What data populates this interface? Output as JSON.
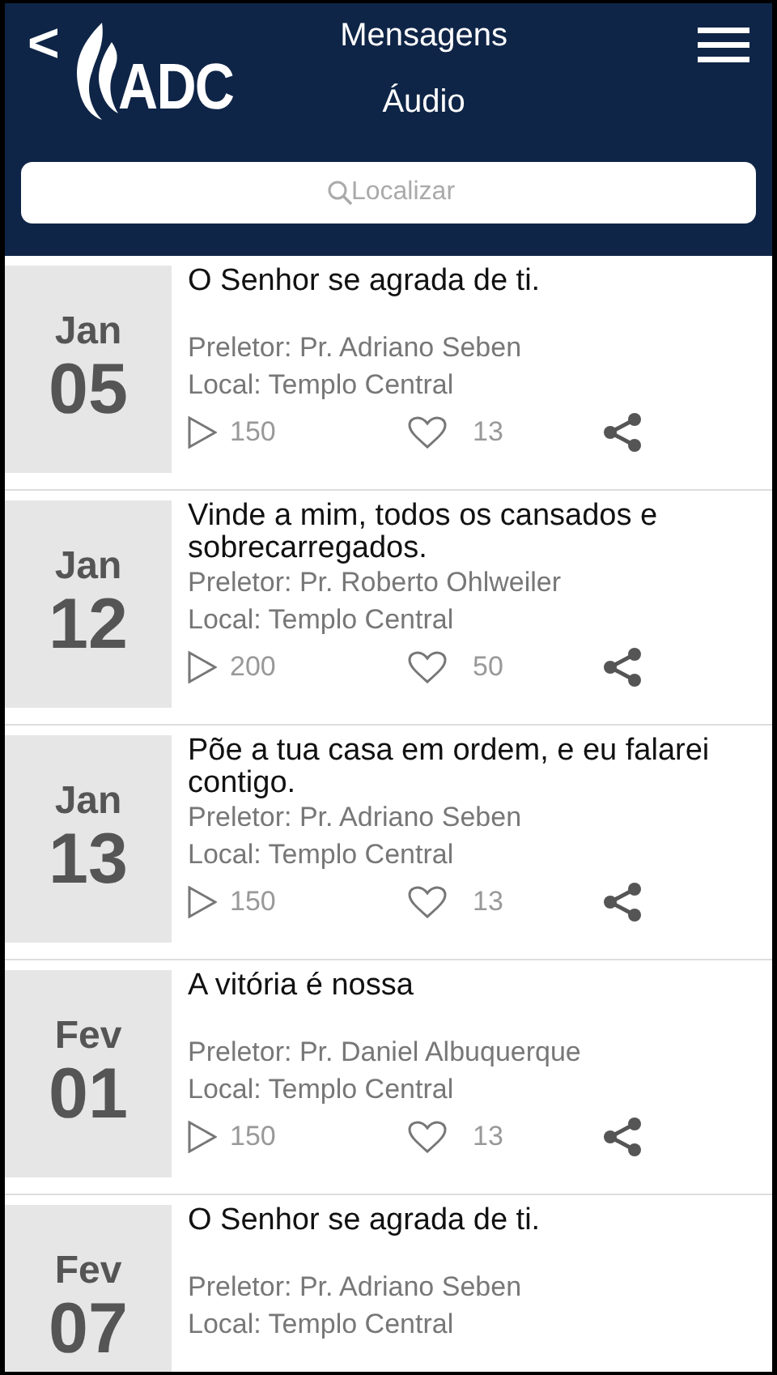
{
  "header": {
    "back": "<",
    "title": "Mensagens",
    "subtitle": "Áudio",
    "logo_text": "ADC"
  },
  "search": {
    "placeholder": "Localizar"
  },
  "messages": [
    {
      "month": "Jan",
      "day": "05",
      "title": "O Senhor se agrada de ti.",
      "preacher": "Preletor: Pr. Adriano Seben",
      "place": "Local: Templo Central",
      "plays": "150",
      "likes": "13"
    },
    {
      "month": "Jan",
      "day": "12",
      "title": "Vinde a mim, todos os cansados e sobrecarregados.",
      "preacher": "Preletor: Pr. Roberto Ohlweiler",
      "place": "Local: Templo Central",
      "plays": "200",
      "likes": "50"
    },
    {
      "month": "Jan",
      "day": "13",
      "title": "Põe a tua casa em ordem, e eu falarei contigo.",
      "preacher": "Preletor: Pr. Adriano Seben",
      "place": "Local: Templo Central",
      "plays": "150",
      "likes": "13"
    },
    {
      "month": "Fev",
      "day": "01",
      "title": "A vitória é nossa",
      "preacher": "Preletor: Pr. Daniel Albuquerque",
      "place": "Local: Templo Central",
      "plays": "150",
      "likes": "13"
    },
    {
      "month": "Fev",
      "day": "07",
      "title": "O Senhor se agrada de ti.",
      "preacher": "Preletor: Pr. Adriano Seben",
      "place": "Local: Templo Central"
    }
  ]
}
